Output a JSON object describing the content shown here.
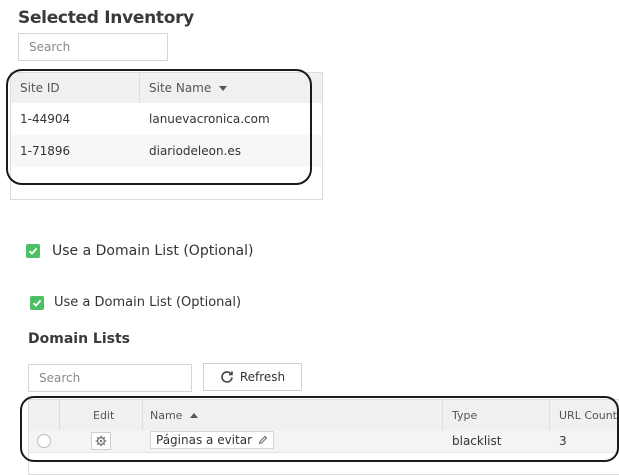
{
  "selected_inventory": {
    "title": "Selected Inventory",
    "search_placeholder": "Search",
    "columns": {
      "site_id": "Site ID",
      "site_name": "Site Name"
    },
    "rows": [
      {
        "site_id": "1-44904",
        "site_name": "lanuevacronica.com"
      },
      {
        "site_id": "1-71896",
        "site_name": "diariodeleon.es"
      }
    ]
  },
  "domain_list_toggle_1": {
    "label": "Use a Domain List (Optional)",
    "checked": true
  },
  "domain_list_toggle_2": {
    "label": "Use a Domain List (Optional)",
    "checked": true
  },
  "domain_lists": {
    "title": "Domain Lists",
    "search_placeholder": "Search",
    "refresh_label": "Refresh",
    "columns": {
      "edit": "Edit",
      "name": "Name",
      "type": "Type",
      "url_count": "URL Count"
    },
    "rows": [
      {
        "name": "Páginas a evitar",
        "type": "blacklist",
        "url_count": "3"
      }
    ]
  },
  "colors": {
    "checkbox": "#4cc065",
    "annotation_outline": "#1a1a1a"
  }
}
